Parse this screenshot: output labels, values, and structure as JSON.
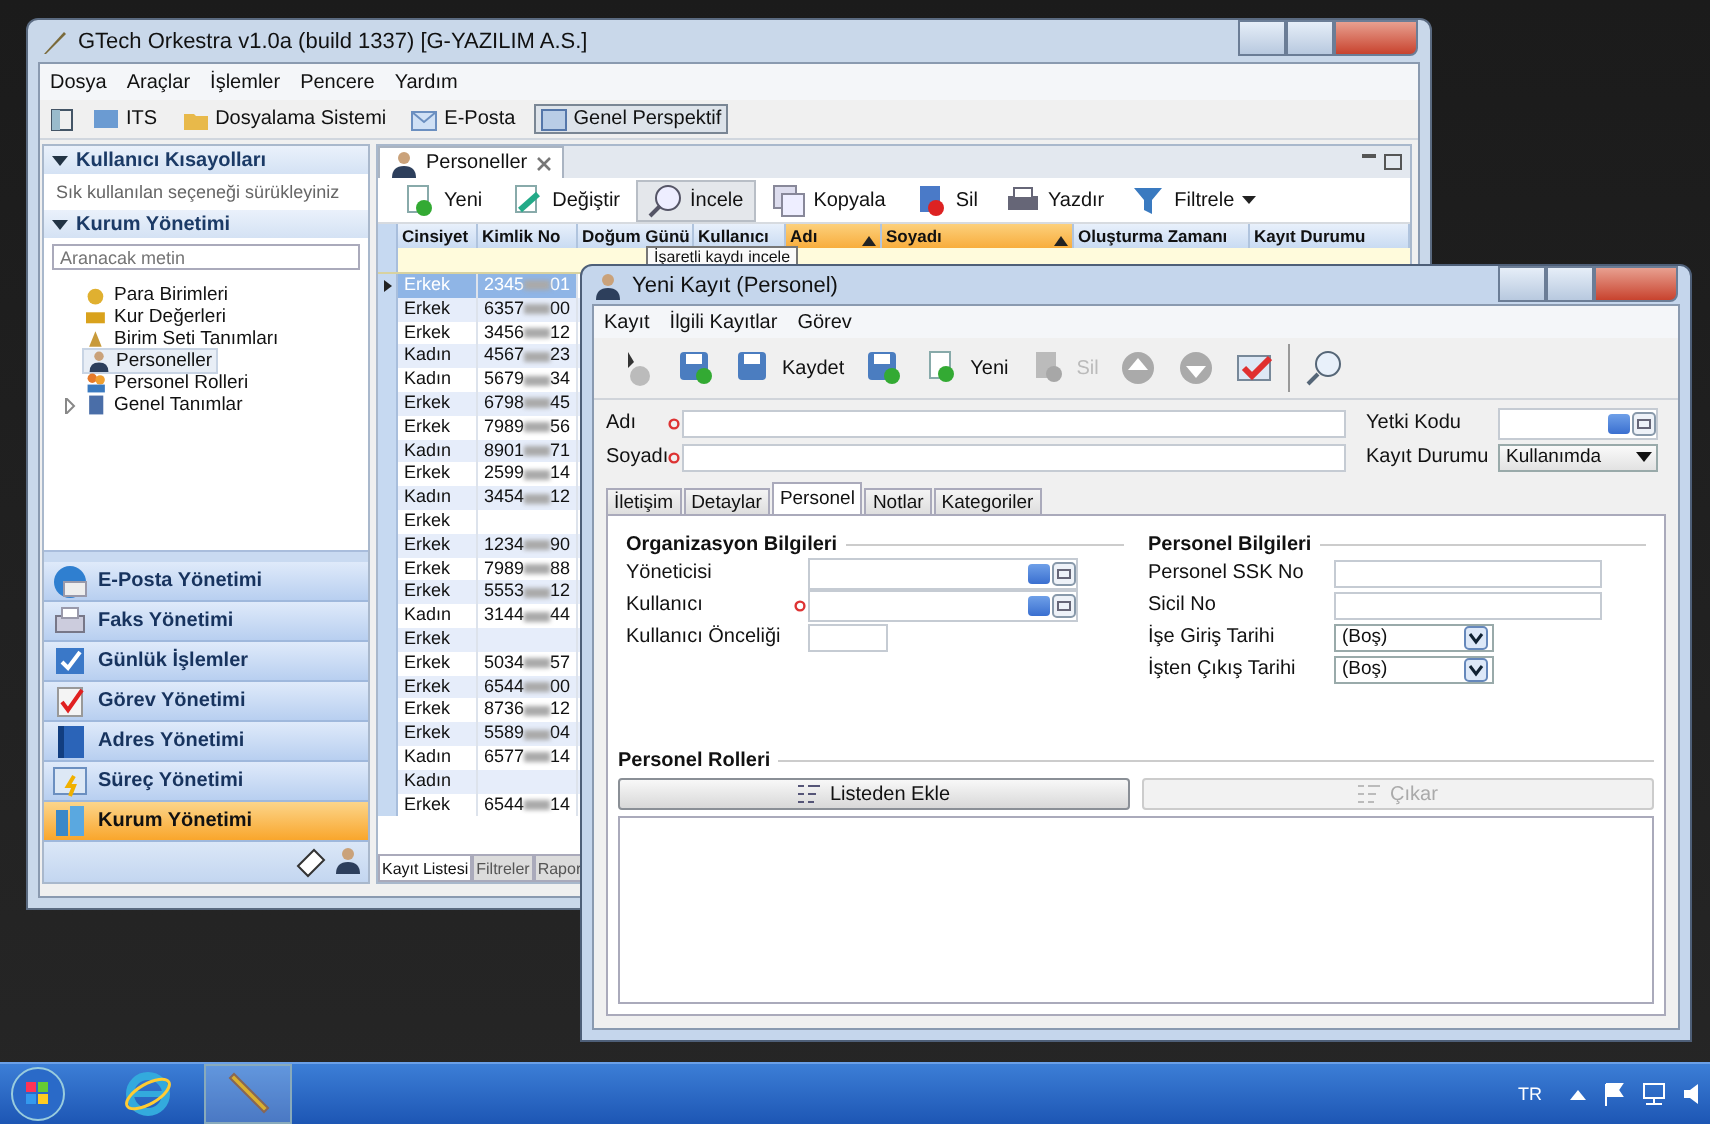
{
  "main_window": {
    "title": "GTech Orkestra v1.0a (build 1337) [G-YAZILIM A.S.]",
    "menu": [
      "Dosya",
      "Araçlar",
      "İşlemler",
      "Pencere",
      "Yardım"
    ],
    "perspectives": [
      {
        "label": "ITS",
        "selected": false
      },
      {
        "label": "Dosyalama Sistemi",
        "selected": false
      },
      {
        "label": "E-Posta",
        "selected": false
      },
      {
        "label": "Genel Perspektif",
        "selected": true
      }
    ]
  },
  "sidebar": {
    "shortcuts_header": "Kullanıcı Kısayolları",
    "shortcuts_hint": "Sık kullanılan seçeneği sürükleyiniz",
    "section_header": "Kurum Yönetimi",
    "search": {
      "placeholder": "Aranacak metin"
    },
    "tree": [
      {
        "label": "Para Birimleri",
        "selected": false
      },
      {
        "label": "Kur Değerleri",
        "selected": false
      },
      {
        "label": "Birim Seti Tanımları",
        "selected": false
      },
      {
        "label": "Personeller",
        "selected": true
      },
      {
        "label": "Personel Rolleri",
        "selected": false
      },
      {
        "label": "Genel Tanımlar",
        "selected": false,
        "expanded": false
      }
    ],
    "modules": [
      {
        "label": "E-Posta Yönetimi",
        "selected": false
      },
      {
        "label": "Faks Yönetimi",
        "selected": false
      },
      {
        "label": "Günlük İşlemler",
        "selected": false
      },
      {
        "label": "Görev Yönetimi",
        "selected": false
      },
      {
        "label": "Adres Yönetimi",
        "selected": false
      },
      {
        "label": "Süreç Yönetimi",
        "selected": false
      },
      {
        "label": "Kurum Yönetimi",
        "selected": true
      }
    ]
  },
  "list_view": {
    "tab": "Personeller",
    "toolbar": [
      {
        "label": "Yeni",
        "pressed": false
      },
      {
        "label": "Değiştir",
        "pressed": false
      },
      {
        "label": "İncele",
        "pressed": true
      },
      {
        "label": "Kopyala",
        "pressed": false
      },
      {
        "label": "Sil",
        "pressed": false
      },
      {
        "label": "Yazdır",
        "pressed": false
      },
      {
        "label": "Filtrele",
        "pressed": false
      }
    ],
    "tooltip": "İşaretli kaydı incele",
    "columns": [
      {
        "label": "Cinsiyet",
        "sorted": false
      },
      {
        "label": "Kimlik No",
        "sorted": false
      },
      {
        "label": "Doğum Günü",
        "sorted": false
      },
      {
        "label": "Kullanıcı",
        "sorted": false
      },
      {
        "label": "Adı",
        "sorted": true
      },
      {
        "label": "Soyadı",
        "sorted": true
      },
      {
        "label": "Oluşturma Zamanı",
        "sorted": false
      },
      {
        "label": "Kayıt Durumu",
        "sorted": false
      }
    ],
    "rows": [
      {
        "cinsiyet": "Erkek",
        "kimlik_start": "2345",
        "kimlik_end": "01",
        "selected": true
      },
      {
        "cinsiyet": "Erkek",
        "kimlik_start": "6357",
        "kimlik_end": "00",
        "selected": false
      },
      {
        "cinsiyet": "Erkek",
        "kimlik_start": "3456",
        "kimlik_end": "12",
        "selected": false
      },
      {
        "cinsiyet": "Kadın",
        "kimlik_start": "4567",
        "kimlik_end": "23",
        "selected": false
      },
      {
        "cinsiyet": "Kadın",
        "kimlik_start": "5679",
        "kimlik_end": "34",
        "selected": false
      },
      {
        "cinsiyet": "Erkek",
        "kimlik_start": "6798",
        "kimlik_end": "45",
        "selected": false
      },
      {
        "cinsiyet": "Erkek",
        "kimlik_start": "7989",
        "kimlik_end": "56",
        "selected": false
      },
      {
        "cinsiyet": "Kadın",
        "kimlik_start": "8901",
        "kimlik_end": "71",
        "selected": false
      },
      {
        "cinsiyet": "Erkek",
        "kimlik_start": "2599",
        "kimlik_end": "14",
        "selected": false
      },
      {
        "cinsiyet": "Kadın",
        "kimlik_start": "3454",
        "kimlik_end": "12",
        "selected": false
      },
      {
        "cinsiyet": "Erkek",
        "selected": false
      },
      {
        "cinsiyet": "Erkek",
        "kimlik_start": "1234",
        "kimlik_end": "90",
        "selected": false
      },
      {
        "cinsiyet": "Erkek",
        "kimlik_start": "7989",
        "kimlik_end": "88",
        "selected": false
      },
      {
        "cinsiyet": "Erkek",
        "kimlik_start": "5553",
        "kimlik_end": "12",
        "selected": false
      },
      {
        "cinsiyet": "Kadın",
        "kimlik_start": "3144",
        "kimlik_end": "44",
        "selected": false
      },
      {
        "cinsiyet": "Erkek",
        "selected": false
      },
      {
        "cinsiyet": "Erkek",
        "kimlik_start": "5034",
        "kimlik_end": "57",
        "selected": false
      },
      {
        "cinsiyet": "Erkek",
        "kimlik_start": "6544",
        "kimlik_end": "00",
        "selected": false
      },
      {
        "cinsiyet": "Erkek",
        "kimlik_start": "8736",
        "kimlik_end": "12",
        "selected": false
      },
      {
        "cinsiyet": "Erkek",
        "kimlik_start": "5589",
        "kimlik_end": "04",
        "selected": false
      },
      {
        "cinsiyet": "Kadın",
        "kimlik_start": "6577",
        "kimlik_end": "14",
        "selected": false
      },
      {
        "cinsiyet": "Kadın",
        "selected": false
      },
      {
        "cinsiyet": "Erkek",
        "kimlik_start": "6544",
        "kimlik_end": "14",
        "selected": false
      }
    ],
    "bottom_tabs": [
      {
        "label": "Kayıt Listesi",
        "selected": true
      },
      {
        "label": "Filtreler",
        "selected": false
      },
      {
        "label": "Rapor",
        "selected": false
      }
    ]
  },
  "dialog": {
    "title": "Yeni Kayıt (Personel)",
    "menu": [
      "Kayıt",
      "İlgili Kayıtlar",
      "Görev"
    ],
    "toolbar": [
      {
        "disabled": false
      },
      {
        "disabled": false
      },
      {
        "label": "Kaydet",
        "disabled": false
      },
      {
        "disabled": false
      },
      {
        "label": "Yeni",
        "disabled": false
      },
      {
        "label": "Sil",
        "disabled": true
      },
      {
        "disabled": false
      },
      {
        "disabled": false
      },
      {
        "disabled": false
      },
      {
        "disabled": false
      }
    ],
    "name_fields": [
      {
        "label": "Adı",
        "required": true
      },
      {
        "label": "Soyadı",
        "required": true
      }
    ],
    "side_fields": [
      {
        "label": "Yetki Kodu",
        "kind": "lookup"
      },
      {
        "label": "Kayıt Durumu",
        "kind": "dropdown",
        "value": "Kullanımda"
      }
    ],
    "tabs": [
      {
        "label": "İletişim",
        "selected": false
      },
      {
        "label": "Detaylar",
        "selected": false
      },
      {
        "label": "Personel",
        "selected": true
      },
      {
        "label": "Notlar",
        "selected": false
      },
      {
        "label": "Kategoriler",
        "selected": false
      }
    ],
    "groups": [
      {
        "title": "Organizasyon Bilgileri",
        "fields": [
          {
            "label": "Yöneticisi",
            "kind": "lookup",
            "required": false
          },
          {
            "label": "Kullanıcı",
            "kind": "lookup",
            "required": true
          },
          {
            "label": "Kullanıcı Önceliği",
            "kind": "short",
            "required": false
          }
        ]
      },
      {
        "title": "Personel Bilgileri",
        "fields": [
          {
            "label": "Personel SSK No",
            "kind": "text",
            "required": false
          },
          {
            "label": "Sicil No",
            "kind": "text",
            "required": false
          },
          {
            "label": "İşe Giriş Tarihi",
            "kind": "dropdown",
            "value": "(Boş)",
            "required": false
          },
          {
            "label": "İşten Çıkış Tarihi",
            "kind": "dropdown",
            "value": "(Boş)",
            "required": false
          }
        ]
      }
    ],
    "roles": {
      "title": "Personel Rolleri",
      "buttons": [
        {
          "label": "Listeden Ekle",
          "disabled": false
        },
        {
          "label": "Çıkar",
          "disabled": true
        }
      ]
    }
  },
  "taskbar": {
    "language": "TR"
  }
}
